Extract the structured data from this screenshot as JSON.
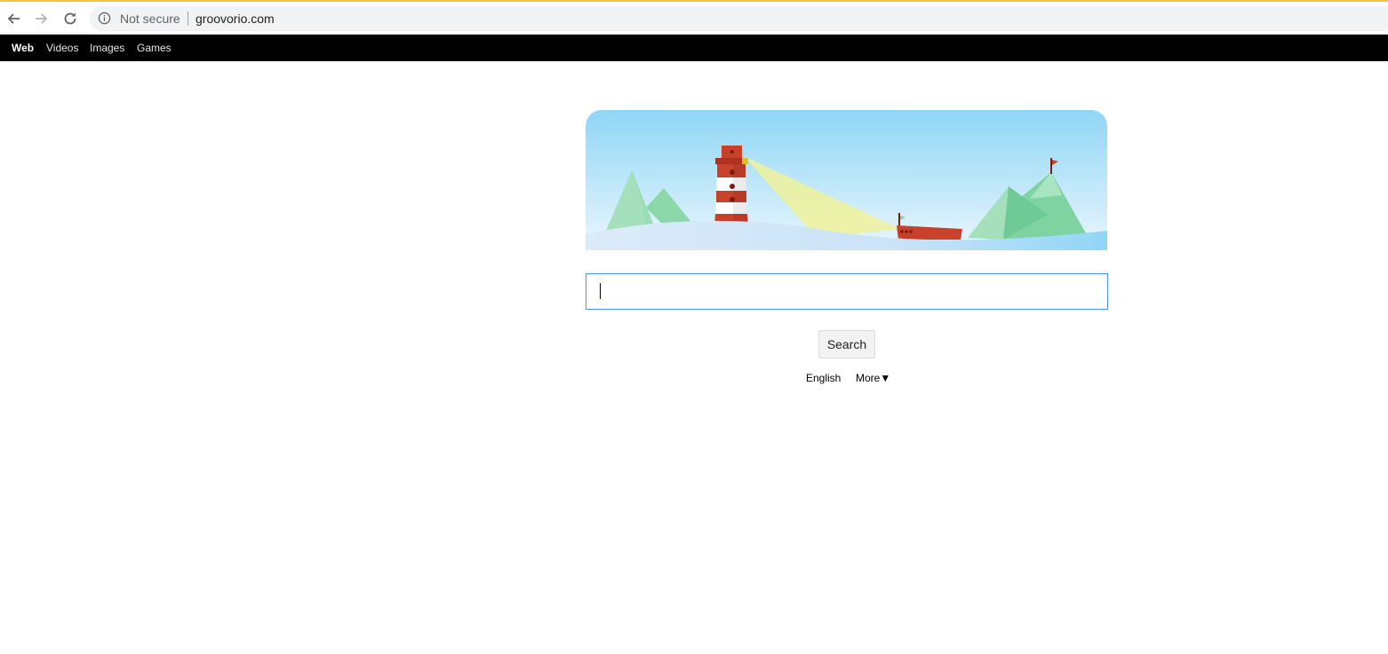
{
  "browser": {
    "security_label": "Not secure",
    "url": "groovorio.com"
  },
  "topnav": {
    "items": [
      {
        "label": "Web",
        "active": true
      },
      {
        "label": "Videos",
        "active": false
      },
      {
        "label": "Images",
        "active": false
      },
      {
        "label": "Games",
        "active": false
      }
    ]
  },
  "search": {
    "value": "",
    "button_label": "Search"
  },
  "footer_links": {
    "language": "English",
    "more": "More▼"
  },
  "colors": {
    "topbar": "#000000",
    "search_border": "#4d90fe",
    "sky_top": "#8fd6f6",
    "lighthouse_red": "#c8412b",
    "mountain_green": "#7fd3a0"
  },
  "icons": [
    "back-arrow-icon",
    "forward-arrow-icon",
    "reload-icon",
    "info-icon",
    "lighthouse-illustration"
  ]
}
